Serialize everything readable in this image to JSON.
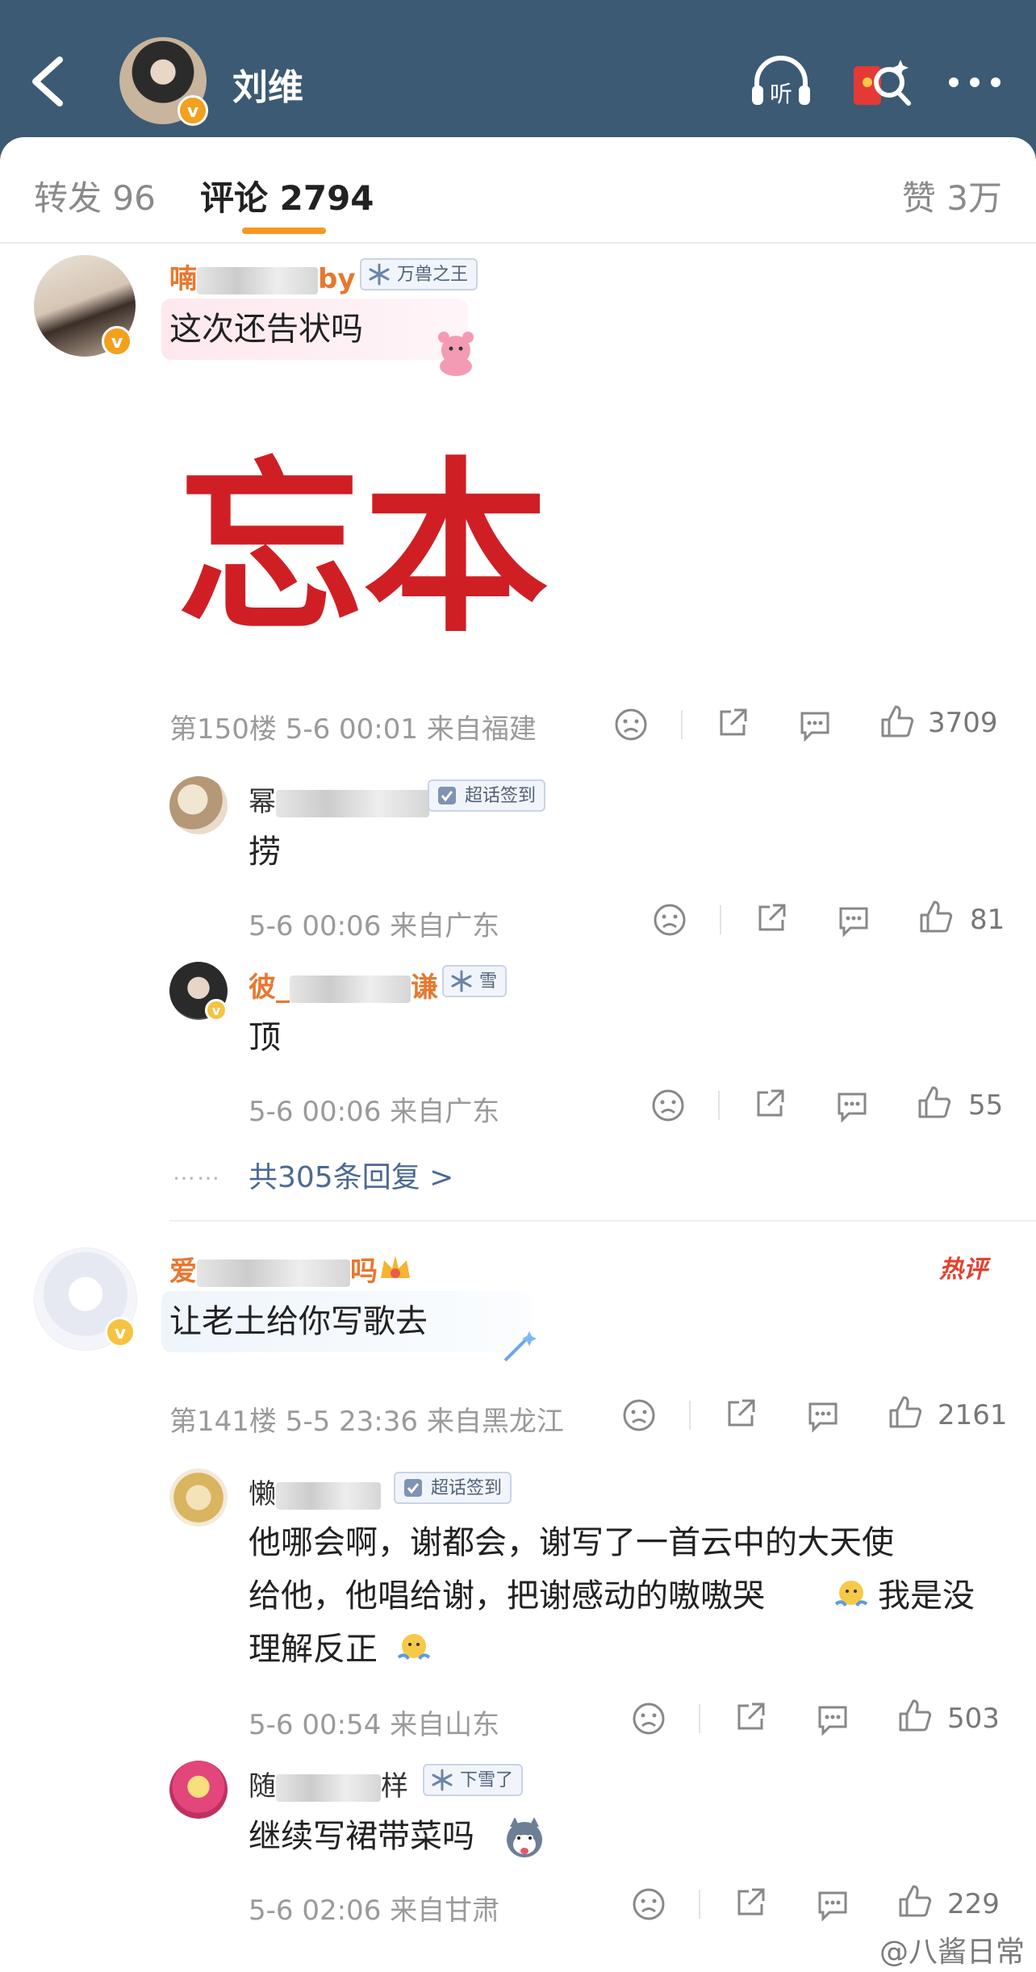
{
  "header": {
    "name": "刘维"
  },
  "tabs": {
    "repost": "转发 96",
    "comment": "评论 2794",
    "like": "赞 3万"
  },
  "comments": [
    {
      "name_visible_start": "喃",
      "name_visible_end": "by",
      "tag": "万兽之王",
      "text": "这次还告状吗",
      "meta": "第150楼 5-6 00:01 来自福建",
      "likes": "3709",
      "replies": [
        {
          "name_visible_start": "幂",
          "tag": "超话签到",
          "text": "捞",
          "meta": "5-6 00:06 来自广东",
          "likes": "81"
        },
        {
          "name_visible_start": "彼_",
          "name_visible_end": "谦",
          "tag": "雪",
          "text": "顶",
          "meta": "5-6 00:06 来自广东",
          "likes": "55"
        }
      ],
      "more": "共305条回复 >",
      "more_dots": "……"
    },
    {
      "name_visible_start": "爱",
      "name_visible_end": "吗",
      "hot": "热评",
      "text": "让老土给你写歌去",
      "meta": "第141楼 5-5 23:36 来自黑龙江",
      "likes": "2161",
      "replies": [
        {
          "name_visible_start": "懒",
          "tag": "超话签到",
          "text_lines": [
            "他哪会啊，谢都会，谢写了一首云中的大天使",
            "给他，他唱给谢，把谢感动的嗷嗷哭",
            "我是没",
            "理解反正"
          ],
          "meta": "5-6 00:54 来自山东",
          "likes": "503"
        },
        {
          "name_visible_start": "随",
          "name_visible_end": "样",
          "tag": "下雪了",
          "text": "继续写裙带菜吗",
          "meta": "5-6 02:06 来自甘肃",
          "likes": "229"
        }
      ]
    }
  ],
  "calligraphy": "忘本",
  "watermark": "@八酱日常",
  "colors": {
    "header_bg": "#3c5a73",
    "accent": "#f8961e",
    "username": "#e7782f",
    "link": "#4c6a92",
    "hot": "#e2412f"
  }
}
